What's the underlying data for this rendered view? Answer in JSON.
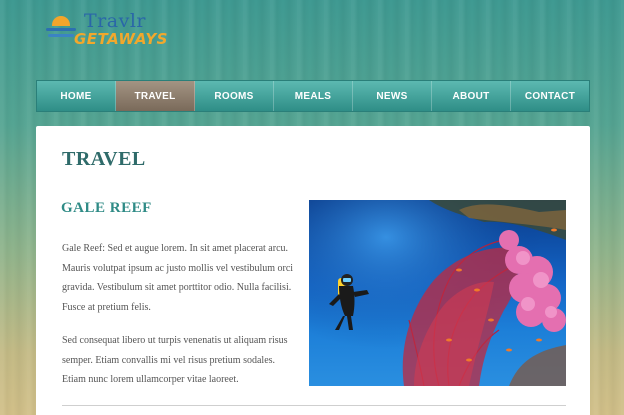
{
  "logo": {
    "line1": "Travlr",
    "line2": "GETAWAYS"
  },
  "nav": {
    "items": [
      {
        "label": "HOME",
        "active": false
      },
      {
        "label": "TRAVEL",
        "active": true
      },
      {
        "label": "ROOMS",
        "active": false
      },
      {
        "label": "MEALS",
        "active": false
      },
      {
        "label": "NEWS",
        "active": false
      },
      {
        "label": "ABOUT",
        "active": false
      },
      {
        "label": "CONTACT",
        "active": false
      }
    ]
  },
  "main": {
    "title": "TRAVEL",
    "section_title": "GALE REEF",
    "paragraphs": [
      "Gale Reef: Sed et augue lorem. In sit amet placerat arcu. Mauris volutpat ipsum ac justo mollis vel vestibulum orci gravida. Vestibulum sit amet porttitor odio. Nulla facilisi. Fusce at pretium felis.",
      "Sed consequat libero ut turpis venenatis ut aliquam risus semper. Etiam convallis mi vel risus pretium sodales. Etiam nunc lorem ullamcorper vitae laoreet."
    ],
    "image_subject": "scuba diver beside pink coral reef"
  },
  "colors": {
    "nav_teal": "#2f8e87",
    "nav_active": "#7a6a5a",
    "title_teal": "#2f6b6a",
    "logo_blue": "#2a67a8",
    "logo_orange": "#f2a82c"
  }
}
